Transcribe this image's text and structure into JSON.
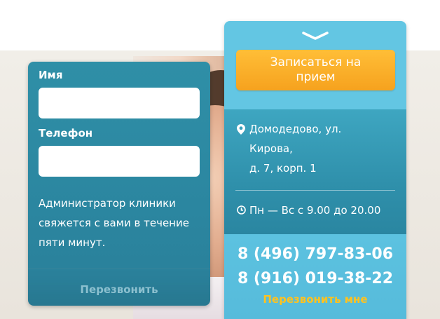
{
  "form": {
    "name_label": "Имя",
    "name_value": "",
    "phone_label": "Телефон",
    "phone_value": "",
    "note": "Администратор клиники свяжется с вами в течение пяти минут.",
    "submit_label": "Перезвонить"
  },
  "info": {
    "book_label": "Записаться на прием",
    "address_lines": [
      "Домодедово, ул.",
      "Кирова,",
      "д. 7, корп. 1"
    ],
    "hours": "Пн — Вс с 9.00 до 20.00",
    "phones": [
      "8 (496) 797-83-06",
      "8 (916) 019-38-22"
    ],
    "callback_label": "Перезвонить мне"
  },
  "icons": {
    "collapse": "chevron-down-icon",
    "location": "map-pin-icon",
    "time": "clock-icon"
  },
  "colors": {
    "form_bg": "#2b86a0",
    "panel_top": "#63c6e3",
    "book_button": "#f6a21e",
    "callback_accent": "#ffc21f"
  }
}
